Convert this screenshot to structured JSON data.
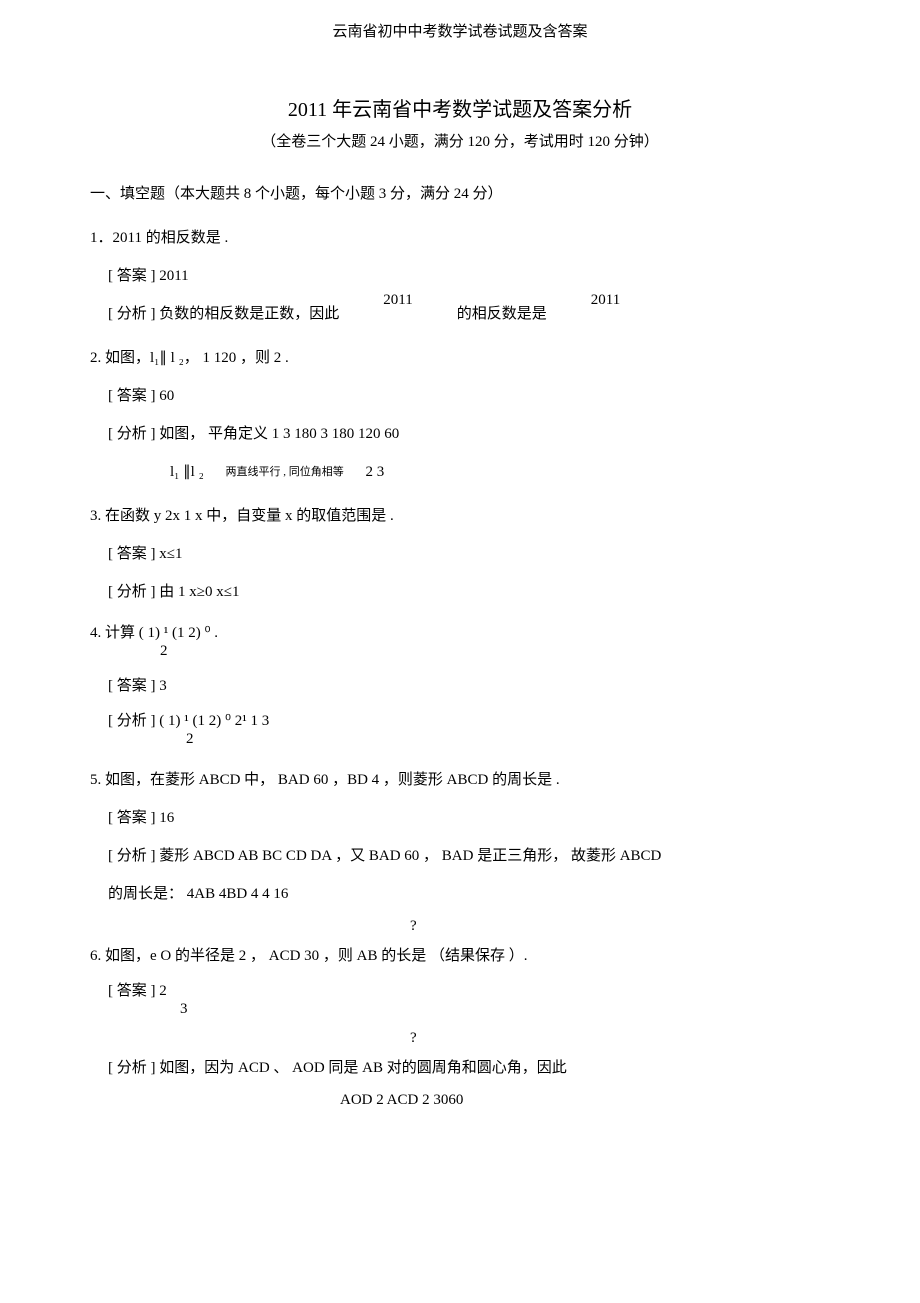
{
  "header": "云南省初中中考数学试卷试题及含答案",
  "title": "2011 年云南省中考数学试题及答案分析",
  "subtitle": "（全卷三个大题   24 小题，满分     120 分，考试用时   120 分钟）",
  "section1_intro": "一、填空题（本大题共    8 个小题，每个小题     3 分，满分  24 分）",
  "q1": {
    "text": "1．2011 的相反数是           .",
    "ans": "[ 答案 ]    2011",
    "ana_left": "[ 分析 ] 负数的相反数是正数，因此",
    "ana_mid": "2011",
    "ana_right_lbl": "的相反数是是",
    "ana_right_val": "2011"
  },
  "q2": {
    "text": "2. 如图，l₁∥ l ₂，    1 120    ，则   2             .",
    "ans": "[ 答案 ]    60",
    "ana1": "[ 分析 ]    如图，  平角定义        1     3  180          3      180    120    60",
    "ana2_l": "l₁ ∥l ₂",
    "ana2_note": "两直线平行 , 同位角相等",
    "ana2_r": "2        3"
  },
  "q3": {
    "text": "3. 在函数  y   2x       1   x 中，自变量  x 的取值范围是            .",
    "ans": "[ 答案 ]    x≤1",
    "ana": "[ 分析 ]    由 1   x≥0    x≤1"
  },
  "q4": {
    "text_top": "4. 计算 ( 1) ¹     (1    2) ⁰               .",
    "text_bot": "2",
    "ans": "[ 答案 ]    3",
    "ana_top": "[ 分析 ]   ( 1) ¹     (1    2) ⁰      2¹   1  3",
    "ana_bot": "2"
  },
  "q5": {
    "text": "5. 如图，在菱形  ABCD 中，     BAD   60    ，BD    4 ，则菱形  ABCD 的周长是             .",
    "ans": "[ 答案 ]    16",
    "ana1": "[ 分析 ]   菱形 ABCD      AB    BC    CD      DA ，又      BAD   60 ，      BAD 是正三角形，  故菱形  ABCD",
    "ana2": "的周长是：   4AB   4BD       4    4   16"
  },
  "q6": {
    "qmark": "?",
    "text": "6. 如图，e O  的半径是  2 ，   ACD     30   ，则 AB 的长是                    （结果保存      ）.",
    "ans_top": "[ 答案 ]    2",
    "ans_bot": "3",
    "qmark2": "?",
    "ana1": "[ 分析 ]   如图，因为      ACD  、    AOD  同是  AB 对的圆周角和圆心角，因此",
    "ana2": "AOD       2      ACD        2   3060"
  }
}
